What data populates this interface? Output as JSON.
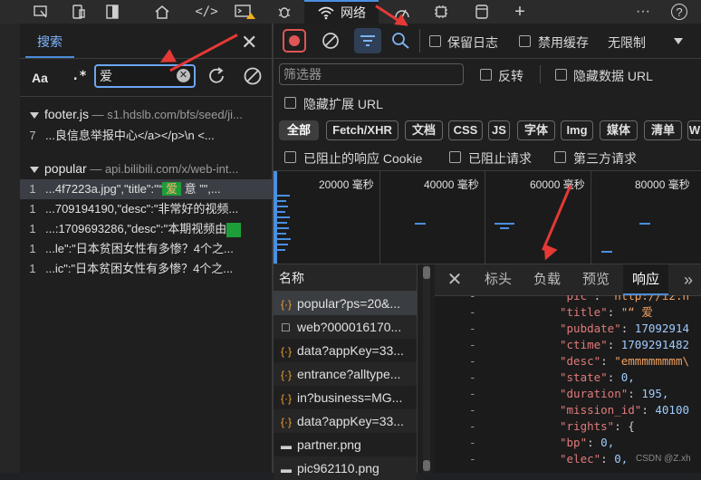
{
  "toolbar": {
    "network_tab": "网络",
    "more": "···",
    "help": "?"
  },
  "search": {
    "tab_label": "搜索",
    "match_case": "Aa",
    "regex": ".*",
    "query": "爱",
    "results": [
      {
        "file": "footer.js",
        "url": "— s1.hdslb.com/bfs/seed/ji...",
        "lines": [
          {
            "num": "7",
            "text": "...良信息举报中心</a></p>\\n     <..."
          }
        ]
      },
      {
        "file": "popular",
        "url": "— api.bilibili.com/x/web-int...",
        "lines": [
          {
            "num": "1",
            "pre": "...4f7223a.jpg\",\"title\":\"“",
            "hl": "爱",
            "post": " 意 ”\",...",
            "selected": true
          },
          {
            "num": "1",
            "text": "...709194190,\"desc\":\"非常好的视频..."
          },
          {
            "num": "1",
            "text": "...:1709693286,\"desc\":\"本期视频由"
          },
          {
            "num": "1",
            "text": "...le\":\"日本贫困女性有多惨？4个之..."
          },
          {
            "num": "1",
            "text": "...ic\":\"日本贫困女性有多惨？4个之..."
          }
        ]
      }
    ]
  },
  "network": {
    "preserve_log": "保留日志",
    "disable_cache": "禁用缓存",
    "throttle": "无限制",
    "filter_placeholder": "筛选器",
    "invert": "反转",
    "hide_data_url": "隐藏数据 URL",
    "hide_ext_url": "隐藏扩展 URL",
    "type_filters": [
      "全部",
      "Fetch/XHR",
      "文档",
      "CSS",
      "JS",
      "字体",
      "Img",
      "媒体",
      "清单",
      "W"
    ],
    "blocked_cookies": "已阻止的响应 Cookie",
    "blocked_requests": "已阻止请求",
    "third_party": "第三方请求",
    "timeline_labels": [
      "20000 毫秒",
      "40000 毫秒",
      "60000 毫秒",
      "80000 毫秒"
    ],
    "name_header": "名称",
    "requests": [
      {
        "icon": "{·}",
        "name": "popular?ps=20&..."
      },
      {
        "icon": "☐",
        "name": "web?000016170..."
      },
      {
        "icon": "{·}",
        "name": "data?appKey=33..."
      },
      {
        "icon": "{·}",
        "name": "entrance?alltype..."
      },
      {
        "icon": "{·}",
        "name": "in?business=MG..."
      },
      {
        "icon": "{·}",
        "name": "data?appKey=33..."
      },
      {
        "icon": "▬",
        "name": "partner.png"
      },
      {
        "icon": "▬",
        "name": "pic962110.png"
      }
    ],
    "detail_tabs": [
      "标头",
      "负载",
      "预览",
      "响应"
    ],
    "response_lines": [
      {
        "k": "\"pic\"",
        "v": " \"http://i2.h",
        "t": "s"
      },
      {
        "k": "\"title\"",
        "v": " \"“ 爱",
        "t": "s"
      },
      {
        "k": "\"pubdate\"",
        "v": " 17092914",
        "t": "n"
      },
      {
        "k": "\"ctime\"",
        "v": " 1709291482",
        "t": "n"
      },
      {
        "k": "\"desc\"",
        "v": " \"emmmmmmmm\\",
        "t": "s"
      },
      {
        "k": "\"state\"",
        "v": " 0,",
        "t": "n"
      },
      {
        "k": "\"duration\"",
        "v": " 195,",
        "t": "n"
      },
      {
        "k": "\"mission_id\"",
        "v": " 40100",
        "t": "n"
      },
      {
        "k": "\"rights\"",
        "v": " {",
        "t": "p"
      },
      {
        "k": "    \"bp\"",
        "v": " 0,",
        "t": "n"
      },
      {
        "k": "    \"elec\"",
        "v": " 0,",
        "t": "n"
      }
    ]
  },
  "watermark": "CSDN @Z.xh",
  "colors": {
    "accent": "#4a8bd6",
    "annotation": "#e53935",
    "highlight": "#1e9e3a"
  }
}
